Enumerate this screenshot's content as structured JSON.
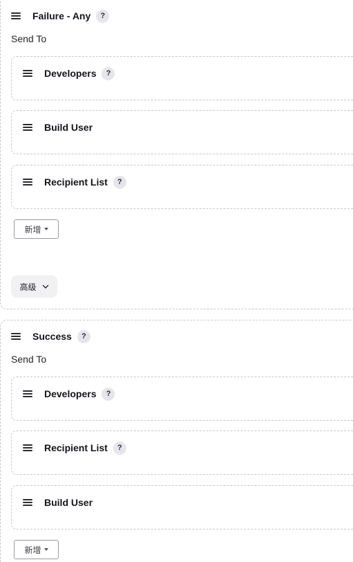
{
  "triggers": [
    {
      "title": "Failure - Any",
      "send_to_label": "Send To",
      "recipients": [
        {
          "label": "Developers",
          "help": "?"
        },
        {
          "label": "Build User"
        },
        {
          "label": "Recipient List",
          "help": "?"
        }
      ],
      "add_label": "新增",
      "advanced_label": "高级",
      "help": "?"
    },
    {
      "title": "Success",
      "send_to_label": "Send To",
      "recipients": [
        {
          "label": "Developers",
          "help": "?"
        },
        {
          "label": "Recipient List",
          "help": "?"
        },
        {
          "label": "Build User"
        }
      ],
      "add_label": "新增",
      "help": "?"
    }
  ]
}
